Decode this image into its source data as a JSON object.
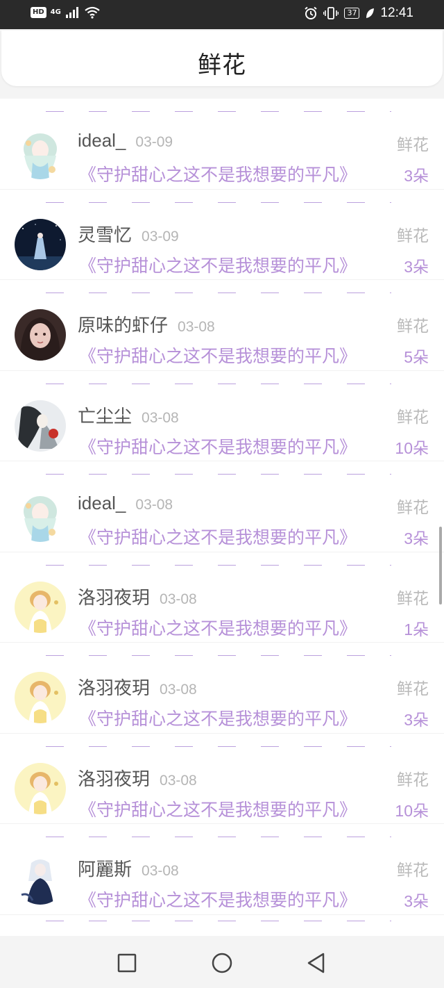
{
  "status_bar": {
    "hd": "HD",
    "network": "4G",
    "battery": "37",
    "time": "12:41"
  },
  "header": {
    "title": "鲜花"
  },
  "rows": [
    {
      "username": "ideal_",
      "date": "03-09",
      "type": "鲜花",
      "book": "《守护甜心之这不是我想要的平凡》",
      "count": "3朵",
      "avatar": "anime-girl-mint"
    },
    {
      "username": "灵雪忆",
      "date": "03-09",
      "type": "鲜花",
      "book": "《守护甜心之这不是我想要的平凡》",
      "count": "3朵",
      "avatar": "night-sky-figure"
    },
    {
      "username": "原味的虾仔",
      "date": "03-08",
      "type": "鲜花",
      "book": "《守护甜心之这不是我想要的平凡》",
      "count": "5朵",
      "avatar": "dark-hair-girl"
    },
    {
      "username": "亡尘尘",
      "date": "03-08",
      "type": "鲜花",
      "book": "《守护甜心之这不是我想要的平凡》",
      "count": "10朵",
      "avatar": "ink-sketch-figure"
    },
    {
      "username": "ideal_",
      "date": "03-08",
      "type": "鲜花",
      "book": "《守护甜心之这不是我想要的平凡》",
      "count": "3朵",
      "avatar": "anime-girl-mint"
    },
    {
      "username": "洛羽夜玥",
      "date": "03-08",
      "type": "鲜花",
      "book": "《守护甜心之这不是我想要的平凡》",
      "count": "1朵",
      "avatar": "sakura-girl-yellow"
    },
    {
      "username": "洛羽夜玥",
      "date": "03-08",
      "type": "鲜花",
      "book": "《守护甜心之这不是我想要的平凡》",
      "count": "3朵",
      "avatar": "sakura-girl-yellow"
    },
    {
      "username": "洛羽夜玥",
      "date": "03-08",
      "type": "鲜花",
      "book": "《守护甜心之这不是我想要的平凡》",
      "count": "10朵",
      "avatar": "sakura-girl-yellow"
    },
    {
      "username": "阿麗斯",
      "date": "03-08",
      "type": "鲜花",
      "book": "《守护甜心之这不是我想要的平凡》",
      "count": "3朵",
      "avatar": "blue-dress-girl"
    }
  ],
  "nav": [
    "recents-icon",
    "home-icon",
    "back-icon"
  ]
}
